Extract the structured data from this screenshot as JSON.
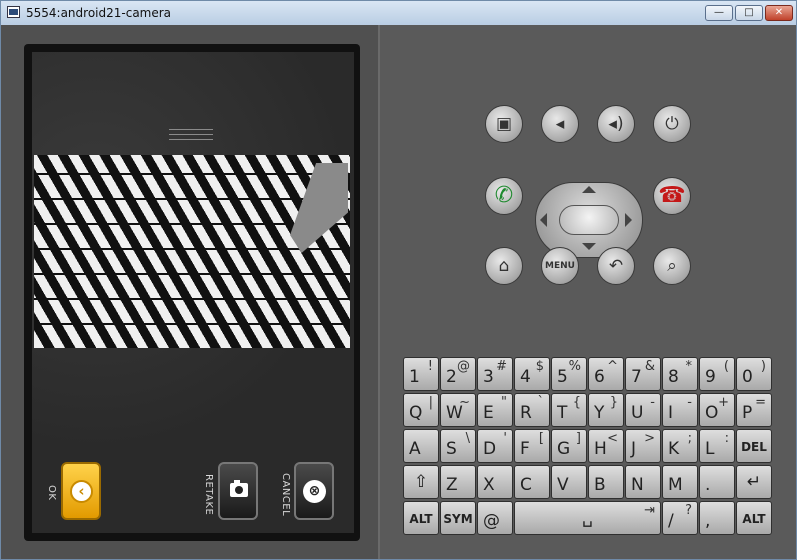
{
  "window": {
    "title": "5554:android21-camera",
    "minimize_glyph": "—",
    "maximize_glyph": "□",
    "close_glyph": "✕"
  },
  "camera": {
    "ok_label": "OK",
    "retake_label": "RETAKE",
    "cancel_label": "CANCEL",
    "ok_icon_glyph": "‹",
    "cancel_icon_glyph": "⊗"
  },
  "controls": {
    "camera_glyph": "▣",
    "vol_down_glyph": "◂",
    "vol_up_glyph": "◂)",
    "power_glyph": "⏻",
    "call_glyph": "✆",
    "end_call_glyph": "☎",
    "home_glyph": "⌂",
    "menu_label": "MENU",
    "back_glyph": "↶",
    "search_glyph": "⌕"
  },
  "keyboard": {
    "rows": [
      [
        [
          "1",
          "!"
        ],
        [
          "2",
          "@"
        ],
        [
          "3",
          "#"
        ],
        [
          "4",
          "$"
        ],
        [
          "5",
          "%"
        ],
        [
          "6",
          "^"
        ],
        [
          "7",
          "&"
        ],
        [
          "8",
          "*"
        ],
        [
          "9",
          "("
        ],
        [
          "0",
          ")"
        ]
      ],
      [
        [
          "Q",
          "|"
        ],
        [
          "W",
          "~"
        ],
        [
          "E",
          "\""
        ],
        [
          "R",
          "`"
        ],
        [
          "T",
          "{"
        ],
        [
          "Y",
          "}"
        ],
        [
          "U",
          "-"
        ],
        [
          "I",
          "-"
        ],
        [
          "O",
          "+"
        ],
        [
          "P",
          "="
        ]
      ],
      [
        [
          "A",
          ""
        ],
        [
          "S",
          "\\"
        ],
        [
          "D",
          "'"
        ],
        [
          "F",
          "["
        ],
        [
          "G",
          "]"
        ],
        [
          "H",
          "<"
        ],
        [
          "J",
          ">"
        ],
        [
          "K",
          ";"
        ],
        [
          "L",
          ":"
        ],
        [
          "DEL",
          ""
        ]
      ],
      [
        [
          "⇧",
          ""
        ],
        [
          "Z",
          ""
        ],
        [
          "X",
          ""
        ],
        [
          "C",
          ""
        ],
        [
          "V",
          ""
        ],
        [
          "B",
          ""
        ],
        [
          "N",
          ""
        ],
        [
          "M",
          ""
        ],
        [
          ".",
          ""
        ],
        [
          "↵",
          ""
        ]
      ]
    ],
    "bottom": {
      "alt_left": "ALT",
      "sym": "SYM",
      "at": "@",
      "space_glyph": "␣",
      "space_tab_glyph": "⇥",
      "slash": "/",
      "slash_alt": "?",
      "comma": ",",
      "alt_right": "ALT"
    }
  }
}
